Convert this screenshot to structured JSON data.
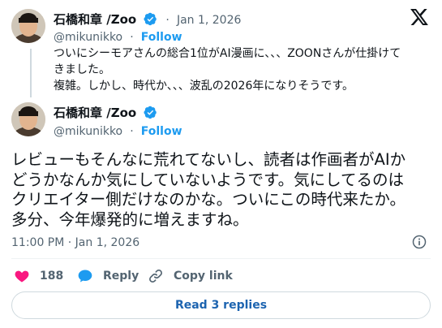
{
  "quoted_tweet": {
    "author_name": "石橋和章 /Zoo",
    "date": "Jan 1, 2026",
    "dot": "·",
    "handle": "@mikunikko",
    "dot2": "·",
    "follow_label": "Follow",
    "lines": [
      "ついにシーモアさんの総合1位がAI漫画に、、、ZOONさんが仕掛けて",
      "きました。",
      "複雑。しかし、時代か、、、波乱の2026年になりそうです。"
    ]
  },
  "main_tweet": {
    "author_name": "石橋和章 /Zoo",
    "handle": "@mikunikko",
    "dot": "·",
    "follow_label": "Follow",
    "lines": [
      "レビューもそんなに荒れてないし、読者は作画者がAIか",
      "どうかなんか気にしていないようです。気にしてるのは",
      "クリエイター側だけなのかな。ついにこの時代来たか。",
      "多分、今年爆発的に増えますね。"
    ],
    "timestamp": "11:00 PM · Jan 1, 2026"
  },
  "actions": {
    "like_count": "188",
    "reply_label": "Reply",
    "copy_link_label": "Copy link"
  },
  "read_replies_label": "Read 3 replies",
  "icons": {
    "verified": "verified-badge-icon",
    "x_logo": "x-logo-icon",
    "info": "info-icon",
    "heart": "heart-icon",
    "reply": "reply-bubble-icon",
    "link": "link-icon"
  },
  "colors": {
    "accent": "#1d9bf0",
    "like": "#f91880",
    "text": "#0f1419",
    "muted": "#536471",
    "replies_link": "#1d64b0"
  }
}
